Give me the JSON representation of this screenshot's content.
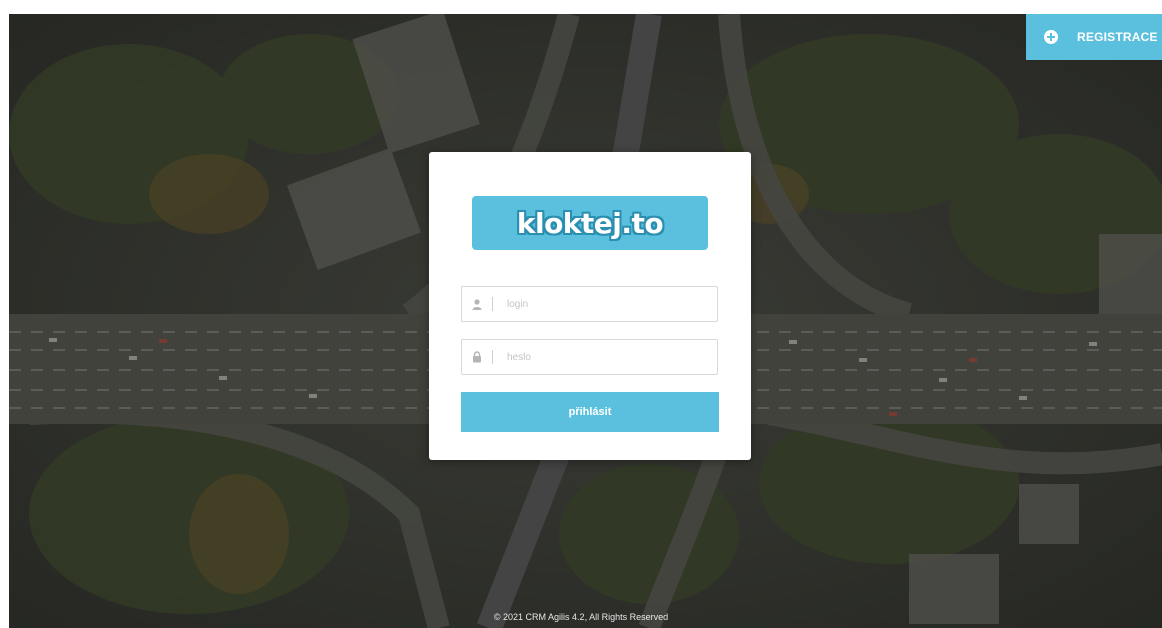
{
  "header": {
    "register_label": "REGISTRACE",
    "register_icon": "plus-circle-icon"
  },
  "login": {
    "logo_text": "kloktej.to",
    "login_field": {
      "placeholder": "login",
      "value": "",
      "icon": "user-icon"
    },
    "password_field": {
      "placeholder": "heslo",
      "value": "",
      "icon": "lock-icon"
    },
    "submit_label": "přihlásit"
  },
  "footer": {
    "copyright": "© 2021 CRM Agilis 4.2, All Rights Reserved"
  },
  "colors": {
    "accent": "#5bc0de",
    "card": "#ffffff",
    "background_overlay": "#3b3d36"
  }
}
